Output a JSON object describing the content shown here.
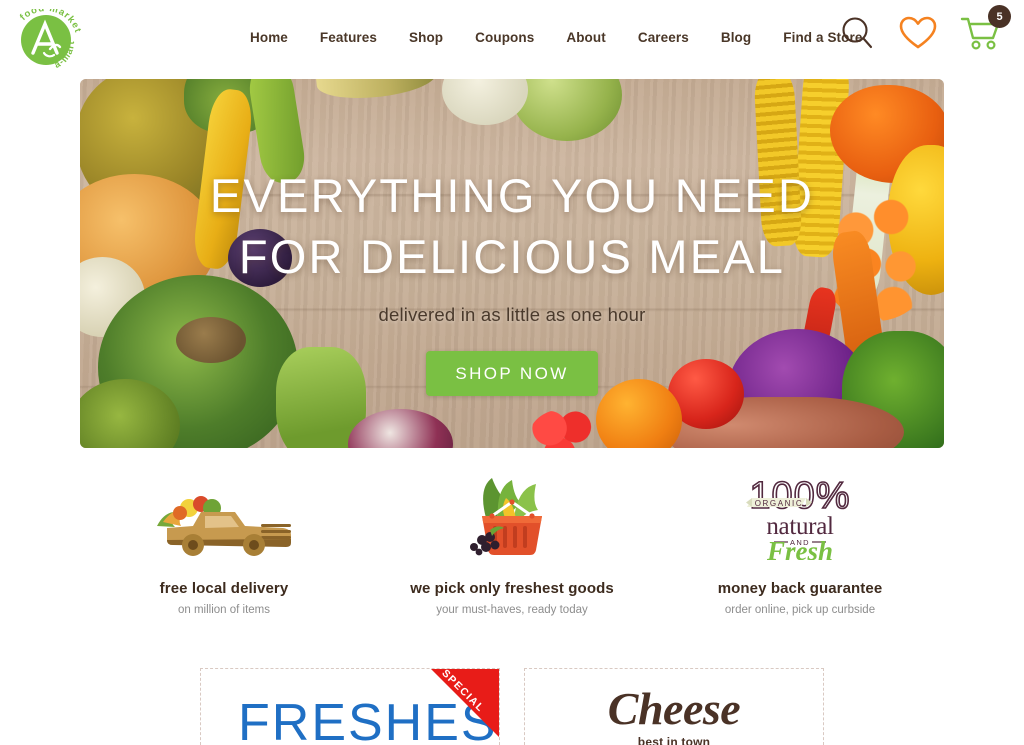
{
  "brand": {
    "name": "a-mart food market",
    "ring_text_top": "food market",
    "ring_text_bottom": "a-mart",
    "monogram": "A",
    "color": "#7ac043"
  },
  "nav": {
    "items": [
      {
        "label": "Home"
      },
      {
        "label": "Features"
      },
      {
        "label": "Shop"
      },
      {
        "label": "Coupons"
      },
      {
        "label": "About"
      },
      {
        "label": "Careers"
      },
      {
        "label": "Blog"
      },
      {
        "label": "Find a Store"
      }
    ]
  },
  "header_icons": {
    "search": "search-icon",
    "wishlist": "heart-icon",
    "cart": "cart-icon",
    "cart_count": "5",
    "search_color": "#4a3226",
    "wishlist_color": "#f58220",
    "cart_color": "#7ac043",
    "badge_color": "#4a3226"
  },
  "hero": {
    "headline_line1": "Everything you need",
    "headline_line2": "for delicious meal",
    "subheadline": "delivered in as little as one hour",
    "cta_label": "Shop Now",
    "cta_color": "#7ac043"
  },
  "features": [
    {
      "icon": "delivery-truck-icon",
      "title": "free local delivery",
      "subtitle": "on million of items"
    },
    {
      "icon": "shopping-basket-icon",
      "title": "we pick only freshest goods",
      "subtitle": "your must-haves, ready today"
    },
    {
      "icon": "natural-fresh-badge-icon",
      "title": "money back guarantee",
      "subtitle": "order online, pick up curbside"
    }
  ],
  "badge": {
    "percent": "100%",
    "organic": "ORGANIC",
    "natural": "natural",
    "and": "AND",
    "fresh": "Fresh",
    "dark_color": "#52293f",
    "green_color": "#7ac043"
  },
  "promos": [
    {
      "title": "Freshest",
      "ribbon": "SPECIAL",
      "title_color": "#1f6fc4",
      "ribbon_color": "#e81c18"
    },
    {
      "title": "Cheese",
      "subtitle": "best in town",
      "title_color": "#4a3226"
    }
  ]
}
